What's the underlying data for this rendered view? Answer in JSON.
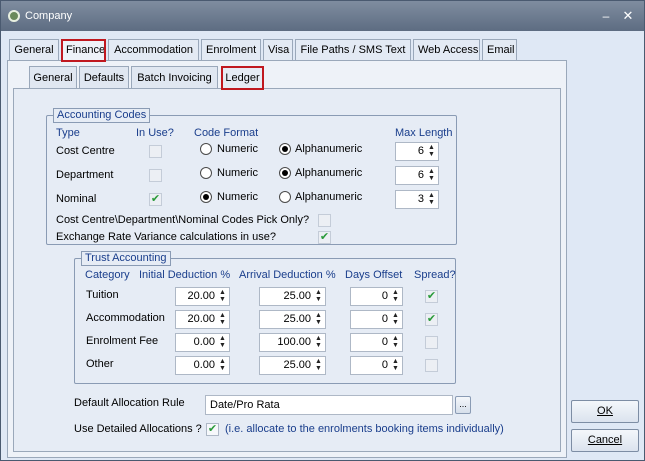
{
  "window": {
    "title": "Company"
  },
  "main_tabs": [
    {
      "label": "General"
    },
    {
      "label": "Finance"
    },
    {
      "label": "Accommodation"
    },
    {
      "label": "Enrolment"
    },
    {
      "label": "Visa"
    },
    {
      "label": "File Paths / SMS Text"
    },
    {
      "label": "Web Access"
    },
    {
      "label": "Email"
    }
  ],
  "sub_tabs": [
    {
      "label": "General"
    },
    {
      "label": "Defaults"
    },
    {
      "label": "Batch Invoicing"
    },
    {
      "label": "Ledger"
    }
  ],
  "accounting_codes": {
    "title": "Accounting Codes",
    "headers": {
      "type": "Type",
      "in_use": "In Use?",
      "code_format": "Code Format",
      "max_length": "Max Length"
    },
    "radio_numeric": "Numeric",
    "radio_alpha": "Alphanumeric",
    "rows": [
      {
        "label": "Cost Centre",
        "in_use": false,
        "format": "Alphanumeric",
        "max_length": "6"
      },
      {
        "label": "Department",
        "in_use": false,
        "format": "Alphanumeric",
        "max_length": "6"
      },
      {
        "label": "Nominal",
        "in_use": true,
        "format": "Numeric",
        "max_length": "3"
      }
    ],
    "pick_only_label": "Cost Centre\\Department\\Nominal Codes Pick Only?",
    "pick_only_checked": false,
    "exchange_label": "Exchange Rate Variance calculations in use?",
    "exchange_checked": true
  },
  "trust_accounting": {
    "title": "Trust Accounting",
    "headers": {
      "category": "Category",
      "initial": "Initial Deduction %",
      "arrival": "Arrival Deduction %",
      "days": "Days Offset",
      "spread": "Spread?"
    },
    "rows": [
      {
        "category": "Tuition",
        "initial": "20.00",
        "arrival": "25.00",
        "days": "0",
        "spread": true
      },
      {
        "category": "Accommodation",
        "initial": "20.00",
        "arrival": "25.00",
        "days": "0",
        "spread": true
      },
      {
        "category": "Enrolment Fee",
        "initial": "0.00",
        "arrival": "100.00",
        "days": "0",
        "spread": false
      },
      {
        "category": "Other",
        "initial": "0.00",
        "arrival": "25.00",
        "days": "0",
        "spread": false
      }
    ]
  },
  "allocation": {
    "rule_label": "Default Allocation Rule",
    "rule_value": "Date/Pro Rata",
    "ellipsis": "...",
    "detailed_label": "Use Detailed Allocations ?",
    "detailed_checked": true,
    "detailed_note": "(i.e. allocate to the enrolments booking items individually)"
  },
  "buttons": {
    "ok": "OK",
    "cancel": "Cancel"
  },
  "icons": {
    "check": "✔",
    "spin": "▲▼"
  }
}
